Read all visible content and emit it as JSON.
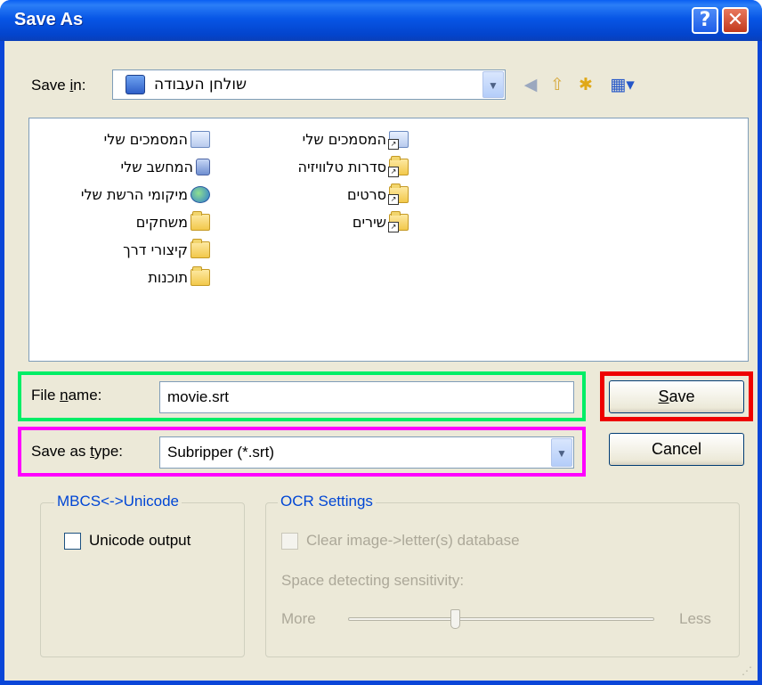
{
  "window": {
    "title": "Save As",
    "help_label": "?",
    "close_label": "✕"
  },
  "save_in": {
    "label_pre": "Save ",
    "label_u": "i",
    "label_post": "n:",
    "value": "שולחן העבודה"
  },
  "files": [
    {
      "name": "המסמכים שלי",
      "icon": "my-documents-icon"
    },
    {
      "name": "המחשב שלי",
      "icon": "my-computer-icon"
    },
    {
      "name": "מיקומי הרשת שלי",
      "icon": "network-places-icon"
    },
    {
      "name": "משחקים",
      "icon": "folder-icon"
    },
    {
      "name": "קיצורי דרך",
      "icon": "folder-icon"
    },
    {
      "name": "תוכנות",
      "icon": "folder-icon"
    },
    {
      "name": "המסמכים שלי",
      "icon": "documents-shortcut-icon"
    },
    {
      "name": "סדרות טלוויזיה",
      "icon": "folder-shortcut-icon"
    },
    {
      "name": "סרטים",
      "icon": "folder-shortcut-icon"
    },
    {
      "name": "שירים",
      "icon": "folder-shortcut-icon"
    }
  ],
  "file_name": {
    "label_pre": "File ",
    "label_u": "n",
    "label_post": "ame:",
    "value": "movie.srt"
  },
  "save_type": {
    "label_pre": "Save as ",
    "label_u": "t",
    "label_post": "ype:",
    "value": "Subripper (*.srt)"
  },
  "buttons": {
    "save_u": "S",
    "save_rest": "ave",
    "cancel": "Cancel"
  },
  "mbcs": {
    "title": "MBCS<->Unicode",
    "unicode_output": "Unicode output",
    "unicode_checked": false
  },
  "ocr": {
    "title": "OCR Settings",
    "clear_db": "Clear image->letter(s) database",
    "sensitivity_label": "Space detecting sensitivity:",
    "more": "More",
    "less": "Less",
    "sensitivity_level": 0.35
  },
  "colors": {
    "title_bar": "#0a5ff3",
    "highlight_filename": "#00ee66",
    "highlight_save": "#ee0000",
    "highlight_type": "#ff00ff"
  }
}
